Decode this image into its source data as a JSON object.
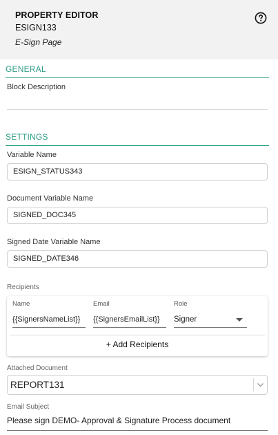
{
  "header": {
    "title": "PROPERTY EDITOR",
    "block_id": "ESIGN133",
    "block_type": "E-Sign Page",
    "help_icon": "help-circle-icon"
  },
  "general": {
    "section_title": "GENERAL",
    "block_description_label": "Block Description",
    "block_description_value": ""
  },
  "settings": {
    "section_title": "SETTINGS",
    "variable_name_label": "Variable Name",
    "variable_name_value": "ESIGN_STATUS343",
    "document_variable_label": "Document Variable Name",
    "document_variable_value": "SIGNED_DOC345",
    "signed_date_label": "Signed Date Variable Name",
    "signed_date_value": "SIGNED_DATE346"
  },
  "recipients": {
    "label": "Recipients",
    "columns": {
      "name": "Name",
      "email": "Email",
      "role": "Role"
    },
    "rows": [
      {
        "name": "{{SignersNameList}}",
        "email": "{{SignersEmailList}}",
        "role": "Signer"
      }
    ],
    "add_label": "+ Add Recipients"
  },
  "attached_document": {
    "label": "Attached Document",
    "value": "REPORT131"
  },
  "email_subject": {
    "label": "Email Subject",
    "value": "Please sign DEMO- Approval & Signature Process document"
  },
  "colors": {
    "accent": "#2e9e86",
    "header_bg": "#f2f2f2"
  }
}
